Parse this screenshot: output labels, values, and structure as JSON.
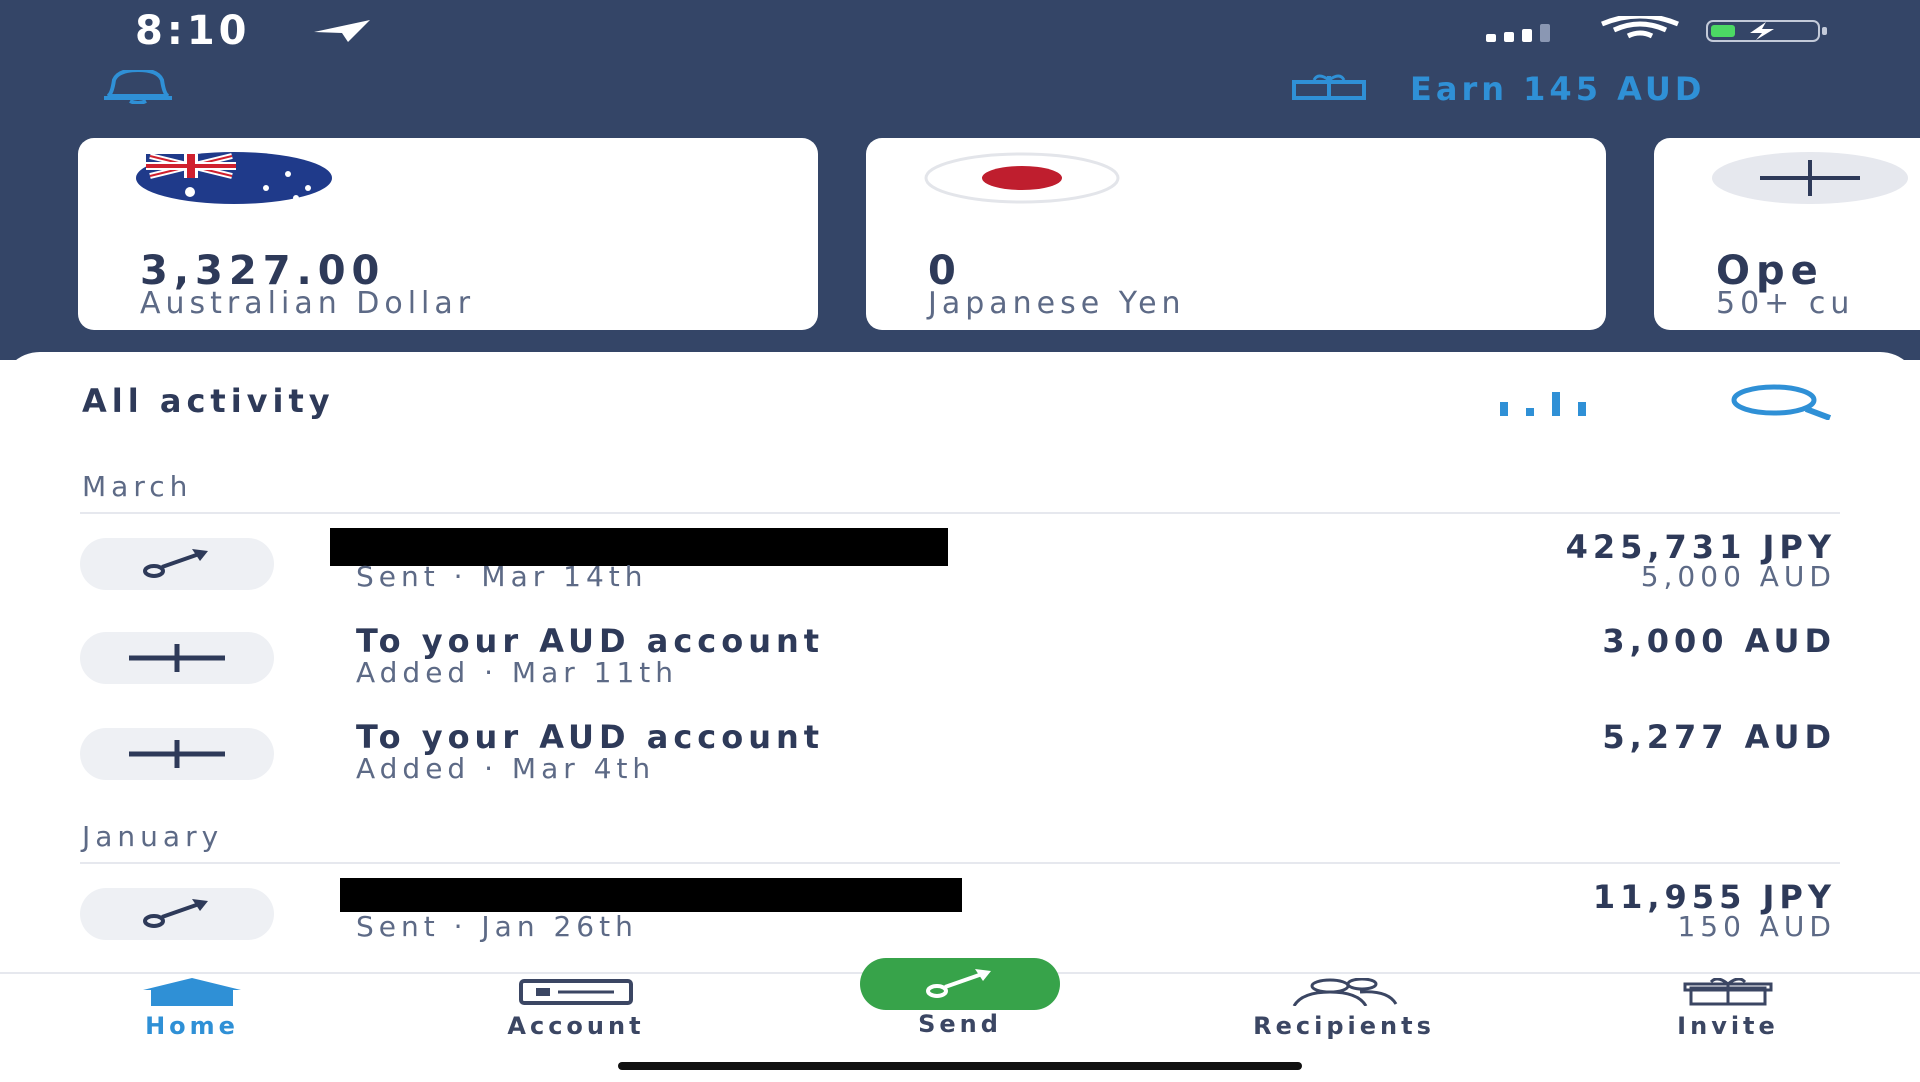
{
  "status_bar": {
    "time": "8:10"
  },
  "header": {
    "earn_label": "Earn 145 AUD"
  },
  "cards": [
    {
      "amount": "3,327.00",
      "currency_name": "Australian Dollar",
      "icon": "australia-flag-icon"
    },
    {
      "amount": "0",
      "currency_name": "Japanese Yen",
      "icon": "japan-flag-icon"
    },
    {
      "amount": "Ope",
      "currency_name": "50+ cu",
      "icon": "plus-icon"
    }
  ],
  "activity": {
    "title": "All activity",
    "groups": [
      {
        "month": "March",
        "items": [
          {
            "title": "",
            "subtitle": "Sent · Mar 14th",
            "amount": "425,731 JPY",
            "amount_sub": "5,000 AUD",
            "icon": "send-arrow-icon",
            "redacted": true
          },
          {
            "title": "To your AUD account",
            "subtitle": "Added · Mar 11th",
            "amount": "3,000 AUD",
            "amount_sub": "",
            "icon": "plus-icon",
            "redacted": false
          },
          {
            "title": "To your AUD account",
            "subtitle": "Added · Mar 4th",
            "amount": "5,277 AUD",
            "amount_sub": "",
            "icon": "plus-icon",
            "redacted": false
          }
        ]
      },
      {
        "month": "January",
        "items": [
          {
            "title": "",
            "subtitle": "Sent · Jan 26th",
            "amount": "11,955 JPY",
            "amount_sub": "150 AUD",
            "icon": "send-arrow-icon",
            "redacted": true
          }
        ]
      }
    ]
  },
  "bottom_nav": {
    "home": "Home",
    "account": "Account",
    "send": "Send",
    "recipients": "Recipients",
    "invite": "Invite",
    "active": "home"
  },
  "colors": {
    "header_bg": "#344567",
    "accent_blue": "#2f90d6",
    "send_green": "#37a34a",
    "text_dark": "#2e3a59"
  }
}
